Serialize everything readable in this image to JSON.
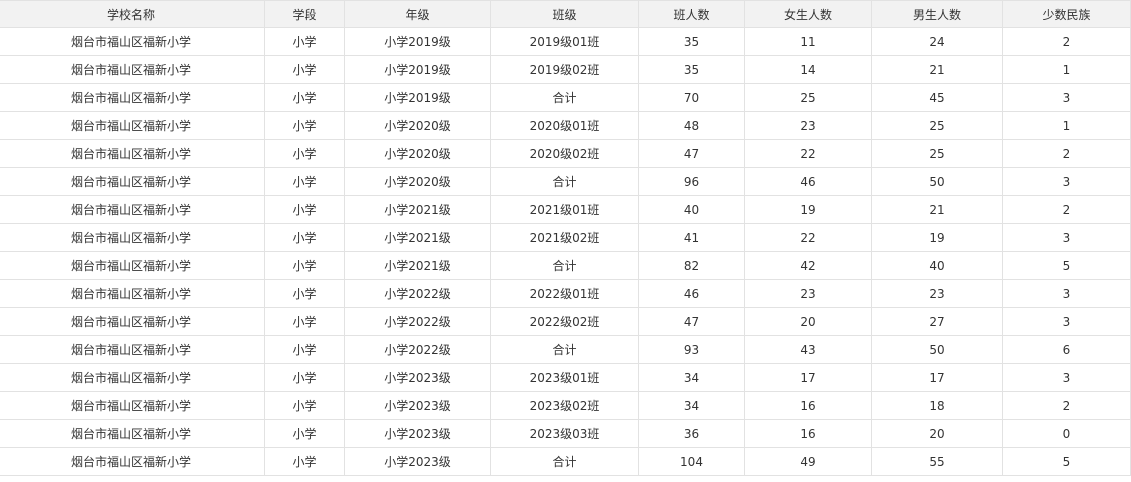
{
  "table": {
    "columns": [
      "学校名称",
      "学段",
      "年级",
      "班级",
      "班人数",
      "女生人数",
      "男生人数",
      "少数民族"
    ],
    "rows": [
      [
        "烟台市福山区福新小学",
        "小学",
        "小学2019级",
        "2019级01班",
        "35",
        "11",
        "24",
        "2"
      ],
      [
        "烟台市福山区福新小学",
        "小学",
        "小学2019级",
        "2019级02班",
        "35",
        "14",
        "21",
        "1"
      ],
      [
        "烟台市福山区福新小学",
        "小学",
        "小学2019级",
        "合计",
        "70",
        "25",
        "45",
        "3"
      ],
      [
        "烟台市福山区福新小学",
        "小学",
        "小学2020级",
        "2020级01班",
        "48",
        "23",
        "25",
        "1"
      ],
      [
        "烟台市福山区福新小学",
        "小学",
        "小学2020级",
        "2020级02班",
        "47",
        "22",
        "25",
        "2"
      ],
      [
        "烟台市福山区福新小学",
        "小学",
        "小学2020级",
        "合计",
        "96",
        "46",
        "50",
        "3"
      ],
      [
        "烟台市福山区福新小学",
        "小学",
        "小学2021级",
        "2021级01班",
        "40",
        "19",
        "21",
        "2"
      ],
      [
        "烟台市福山区福新小学",
        "小学",
        "小学2021级",
        "2021级02班",
        "41",
        "22",
        "19",
        "3"
      ],
      [
        "烟台市福山区福新小学",
        "小学",
        "小学2021级",
        "合计",
        "82",
        "42",
        "40",
        "5"
      ],
      [
        "烟台市福山区福新小学",
        "小学",
        "小学2022级",
        "2022级01班",
        "46",
        "23",
        "23",
        "3"
      ],
      [
        "烟台市福山区福新小学",
        "小学",
        "小学2022级",
        "2022级02班",
        "47",
        "20",
        "27",
        "3"
      ],
      [
        "烟台市福山区福新小学",
        "小学",
        "小学2022级",
        "合计",
        "93",
        "43",
        "50",
        "6"
      ],
      [
        "烟台市福山区福新小学",
        "小学",
        "小学2023级",
        "2023级01班",
        "34",
        "17",
        "17",
        "3"
      ],
      [
        "烟台市福山区福新小学",
        "小学",
        "小学2023级",
        "2023级02班",
        "34",
        "16",
        "18",
        "2"
      ],
      [
        "烟台市福山区福新小学",
        "小学",
        "小学2023级",
        "2023级03班",
        "36",
        "16",
        "20",
        "0"
      ],
      [
        "烟台市福山区福新小学",
        "小学",
        "小学2023级",
        "合计",
        "104",
        "49",
        "55",
        "5"
      ]
    ]
  }
}
